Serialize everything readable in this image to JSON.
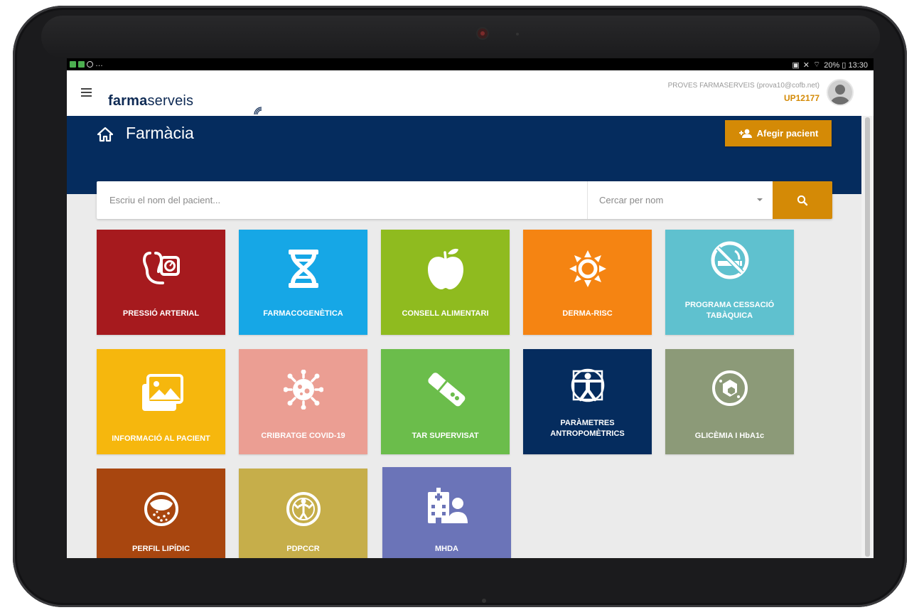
{
  "statusbar": {
    "right_text": "20% ▯ 13:30"
  },
  "appbar": {
    "logo_bold": "farma",
    "logo_light": "serveis",
    "user_name": "PROVES FARMASERVEIS (prova10@cofb.net)",
    "user_code": "UP12177"
  },
  "banner": {
    "title": "Farmàcia",
    "add_button": "Afegir pacient"
  },
  "search": {
    "placeholder": "Escriu el nom del pacient...",
    "mode_selected": "Cercar per nom"
  },
  "tiles": [
    {
      "label": "PRESSIÓ ARTERIAL",
      "color": "#a61a1e",
      "icon": "blood-pressure-icon"
    },
    {
      "label": "FARMACOGENÈTICA",
      "color": "#16a7e6",
      "icon": "dna-icon"
    },
    {
      "label": "CONSELL ALIMENTARI",
      "color": "#8fbb1f",
      "icon": "apple-icon"
    },
    {
      "label": "DERMA-RISC",
      "color": "#f58412",
      "icon": "sun-icon"
    },
    {
      "label": "PROGRAMA CESSACIÓ TABÀQUICA",
      "color": "#5fc1cf",
      "icon": "no-smoking-icon"
    },
    {
      "label": "INFORMACIÓ AL PACIENT",
      "color": "#f6b70d",
      "icon": "images-icon"
    },
    {
      "label": "CRIBRATGE COVID-19",
      "color": "#eb9e93",
      "icon": "virus-icon"
    },
    {
      "label": "TAR SUPERVISAT",
      "color": "#6bbd4b",
      "icon": "test-strip-icon"
    },
    {
      "label": "PARÀMETRES ANTROPOMÈTRICS",
      "color": "#052c5e",
      "icon": "vitruvian-man-icon"
    },
    {
      "label": "GLICÈMIA I HbA1c",
      "color": "#8c9a78",
      "icon": "glucose-icon"
    },
    {
      "label": "PERFIL LIPÍDIC",
      "color": "#a8460f",
      "icon": "lipid-icon"
    },
    {
      "label": "PDPCCR",
      "color": "#c6ae4a",
      "icon": "pdpccr-icon"
    },
    {
      "label": "MHDA",
      "color": "#6b74b8",
      "icon": "hospital-person-icon"
    }
  ]
}
